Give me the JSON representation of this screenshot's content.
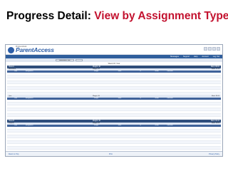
{
  "slide": {
    "title_prefix": "Progress Detail:",
    "title_accent": "View by Assignment Type"
  },
  "app": {
    "brand_small": "Progressbook",
    "brand_name": "ParentAccess",
    "nav": [
      "Messages",
      "Support",
      "Help",
      "Account",
      "Log Out"
    ],
    "filter_value": "Assignment Type"
  },
  "student_line": "Week 18, Year",
  "columns": [
    "Date",
    "Assignment",
    "Weight",
    "Mark",
    "%",
    "Grade",
    "Comment"
  ],
  "classes": [
    {
      "name": "Class A",
      "weight_label": "Weight: 40",
      "mark_label": "Mark: 88.82",
      "categories": [
        {
          "name": "Homework",
          "weight": "Weight: 30",
          "mark": "Mark: 91.20",
          "rows": 8
        },
        {
          "name": "Quiz",
          "weight": "Weight: 30",
          "mark": "Mark: 85.60",
          "rows": 7
        }
      ]
    },
    {
      "name": "Class B",
      "weight_label": "Weight: 40",
      "mark_label": "Mark: 92.10",
      "categories": [
        {
          "name": "Projects",
          "weight": "Weight: 40",
          "mark": "Mark: 93.00",
          "rows": 8
        }
      ]
    }
  ],
  "legend_text": "View Information",
  "footer": {
    "left": "Return to Top",
    "center": "Print",
    "right": "Privacy Policy"
  },
  "colors": {
    "accent": "#c3122f",
    "header_bar": "#2e4d7b",
    "col_header": "#3f6299",
    "category_bar": "#dfe7f4",
    "legend": "#f4e7a4"
  }
}
